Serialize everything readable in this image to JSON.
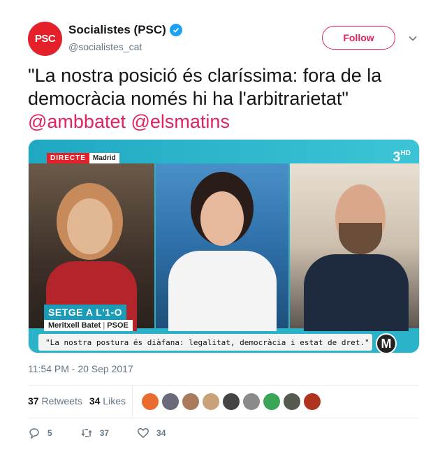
{
  "author": {
    "avatar_text": "PSC",
    "name": "Socialistes (PSC)",
    "handle": "@socialistes_cat",
    "verified": true
  },
  "follow_label": "Follow",
  "tweet": {
    "text": "\"La nostra posició és claríssima: fora de la democràcia només hi ha l'arbitrarietat\"",
    "mentions": [
      "@ambbatet",
      "@elsmatins"
    ]
  },
  "media": {
    "live_label": "DIRECTE",
    "location": "Madrid",
    "channel": "3",
    "channel_suffix": "HD",
    "headline": "SETGE A L'1-O",
    "speaker": "Meritxell Batet",
    "party": "PSOE",
    "ticker": "\"La nostra postura és diàfana: legalitat, democràcia i estat de dret.\"",
    "program_logo": "M"
  },
  "timestamp": "11:54 PM - 20 Sep 2017",
  "stats": {
    "retweets_count": "37",
    "retweets_label": "Retweets",
    "likes_count": "34",
    "likes_label": "Likes"
  },
  "likers_colors": [
    "#e96b2e",
    "#6a6a7a",
    "#a97b5c",
    "#c9a27a",
    "#444444",
    "#8a8a8a",
    "#3aa655",
    "#555a50",
    "#b0331f"
  ],
  "actions": {
    "replies": "5",
    "retweets": "37",
    "likes": "34"
  },
  "colors": {
    "accent": "#e0245e",
    "brand": "#e4202a",
    "verified": "#1da1f2",
    "muted": "#657786"
  }
}
